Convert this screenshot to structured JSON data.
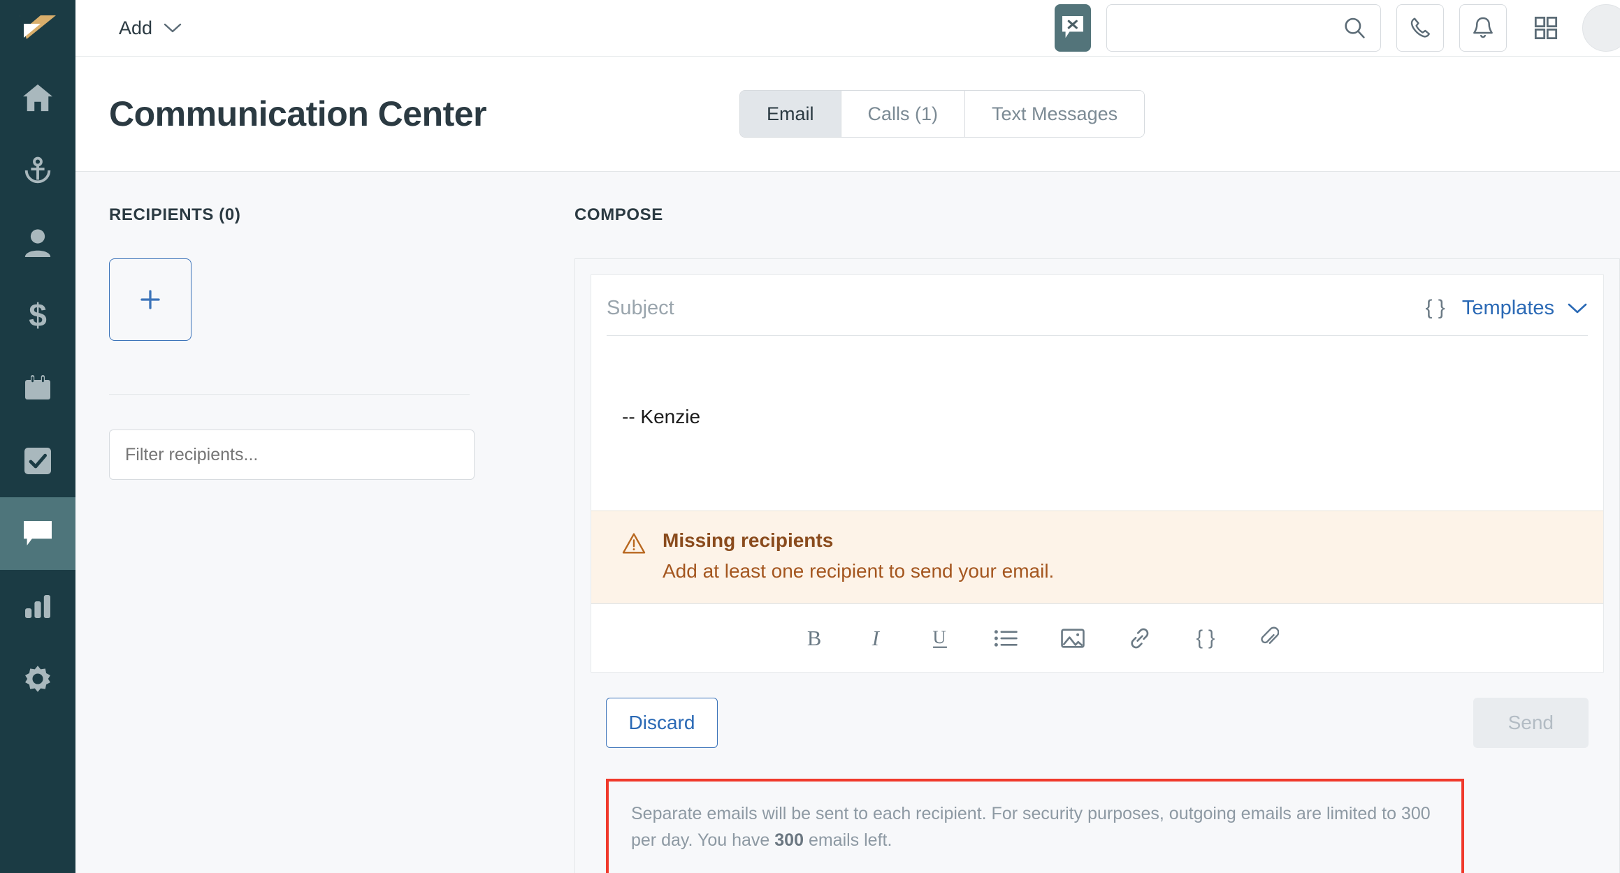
{
  "brand": {
    "logo_name": "angle-logo",
    "rail_bg": "#1b3b44",
    "active_bg": "#4e757b"
  },
  "sidebar": {
    "items": [
      {
        "name": "home",
        "icon": "home-icon",
        "active": false
      },
      {
        "name": "prospecting",
        "icon": "anchor-target-icon",
        "active": false
      },
      {
        "name": "contacts",
        "icon": "person-icon",
        "active": false
      },
      {
        "name": "deals",
        "icon": "dollar-icon",
        "active": false
      },
      {
        "name": "calendar",
        "icon": "calendar-icon",
        "active": false
      },
      {
        "name": "tasks",
        "icon": "checkbox-check-icon",
        "active": false
      },
      {
        "name": "communication",
        "icon": "chat-bubble-icon",
        "active": true
      },
      {
        "name": "reports",
        "icon": "bar-chart-icon",
        "active": false
      },
      {
        "name": "settings",
        "icon": "gear-icon",
        "active": false
      }
    ]
  },
  "topbar": {
    "add_label": "Add",
    "add_caret": "chevron-down-icon",
    "chat_close_icon": "chat-bubble-x-icon",
    "search_placeholder": "",
    "search_value": "",
    "search_icon": "search-icon",
    "phone_icon": "phone-icon",
    "bell_icon": "bell-icon",
    "grid_icon": "grid-apps-icon",
    "avatar": "user-avatar"
  },
  "page": {
    "title": "Communication Center",
    "tabs": [
      {
        "label": "Email",
        "active": true
      },
      {
        "label": "Calls (1)",
        "active": false
      },
      {
        "label": "Text Messages",
        "active": false
      }
    ]
  },
  "recipients": {
    "heading": "RECIPIENTS (0)",
    "add_button_glyph": "+",
    "filter_placeholder": "Filter recipients...",
    "filter_value": ""
  },
  "compose": {
    "heading": "COMPOSE",
    "subject_placeholder": "Subject",
    "subject_value": "",
    "merge_field_icon": "{ }",
    "templates_label": "Templates",
    "templates_caret": "chevron-down-icon",
    "body_text": "-- Kenzie",
    "warning": {
      "icon": "warning-triangle-icon",
      "title": "Missing recipients",
      "message": "Add at least one recipient to send your email."
    },
    "toolbar": [
      {
        "name": "bold",
        "glyph": "B"
      },
      {
        "name": "italic",
        "glyph": "I"
      },
      {
        "name": "underline",
        "glyph": "U"
      },
      {
        "name": "bulleted-list",
        "glyph": "list"
      },
      {
        "name": "insert-image",
        "glyph": "image"
      },
      {
        "name": "insert-link",
        "glyph": "link"
      },
      {
        "name": "merge-field",
        "glyph": "{ }"
      },
      {
        "name": "attachment",
        "glyph": "paperclip"
      }
    ],
    "discard_label": "Discard",
    "send_label": "Send",
    "send_disabled": true
  },
  "notice": {
    "line1": "Separate emails will be sent to each recipient. For security purposes, outgoing emails are limited to 300 per day.",
    "line2_prefix": "You have ",
    "line2_strong": "300",
    "line2_suffix": " emails left.",
    "border_color": "#f0392b"
  }
}
